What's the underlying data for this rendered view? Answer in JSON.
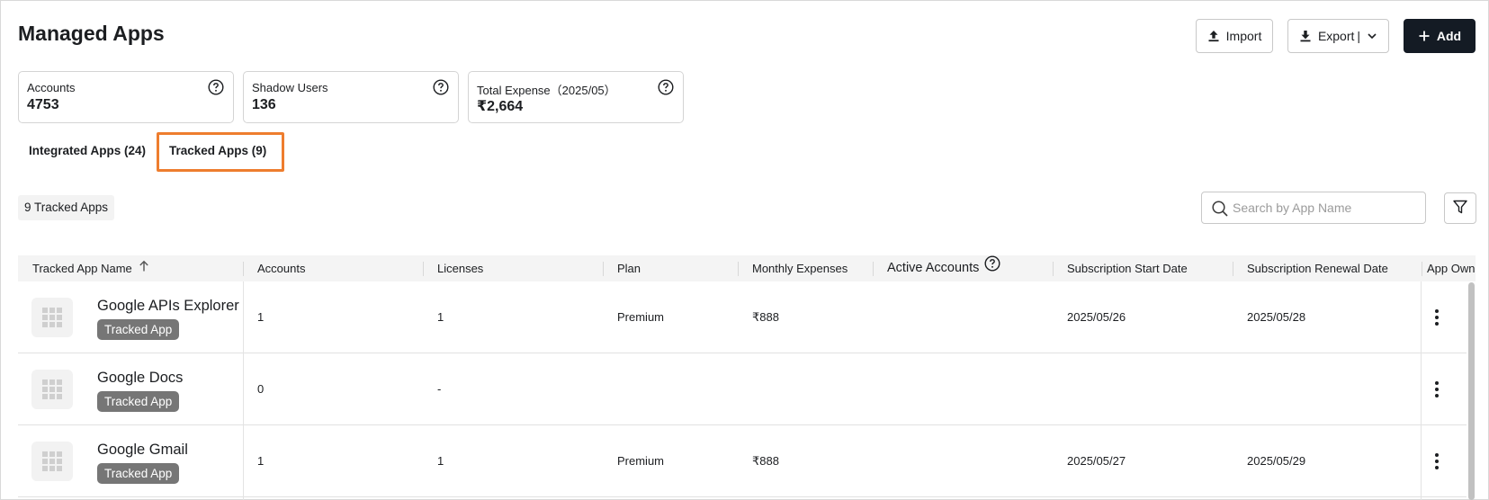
{
  "page": {
    "title": "Managed Apps"
  },
  "toolbar": {
    "import_label": "Import",
    "export_label": "Export",
    "export_separator": "|",
    "add_label": "Add"
  },
  "summary": [
    {
      "label": "Accounts",
      "value": "4753"
    },
    {
      "label": "Shadow Users",
      "value": "136"
    },
    {
      "label": "Total Expense（2025/05）",
      "value": "₹2,664"
    }
  ],
  "tabs": [
    {
      "label": "Integrated Apps (24)"
    },
    {
      "label": "Tracked Apps (9)",
      "active": true
    }
  ],
  "list": {
    "count_label": "9 Tracked Apps"
  },
  "search": {
    "placeholder": "Search by App Name",
    "value": ""
  },
  "table": {
    "columns": [
      "Tracked App Name",
      "Accounts",
      "Licenses",
      "Plan",
      "Monthly Expenses",
      "Active Accounts",
      "Subscription Start Date",
      "Subscription Renewal Date",
      "App Owner"
    ],
    "sort": {
      "column": "Tracked App Name",
      "direction": "asc"
    },
    "rows": [
      {
        "name": "Google APIs Explorer",
        "badge": "Tracked App",
        "accounts": "1",
        "licenses": "1",
        "plan": "Premium",
        "monthly_expenses": "₹888",
        "active_accounts": "",
        "start_date": "2025/05/26",
        "renewal_date": "2025/05/28"
      },
      {
        "name": "Google Docs",
        "badge": "Tracked App",
        "accounts": "0",
        "licenses": "-",
        "plan": "",
        "monthly_expenses": "",
        "active_accounts": "",
        "start_date": "",
        "renewal_date": ""
      },
      {
        "name": "Google Gmail",
        "badge": "Tracked App",
        "accounts": "1",
        "licenses": "1",
        "plan": "Premium",
        "monthly_expenses": "₹888",
        "active_accounts": "",
        "start_date": "2025/05/27",
        "renewal_date": "2025/05/29"
      }
    ]
  },
  "colors": {
    "accent_dark": "#141b24",
    "tab_highlight": "#ee7d2e",
    "badge_bg": "#767676",
    "header_bg": "#f4f4f4"
  },
  "icons": [
    "upload-icon",
    "download-icon",
    "chevron-down-icon",
    "plus-icon",
    "help-icon",
    "search-icon",
    "filter-icon",
    "sort-ascending-icon",
    "app-grid-icon",
    "more-vertical-icon"
  ]
}
